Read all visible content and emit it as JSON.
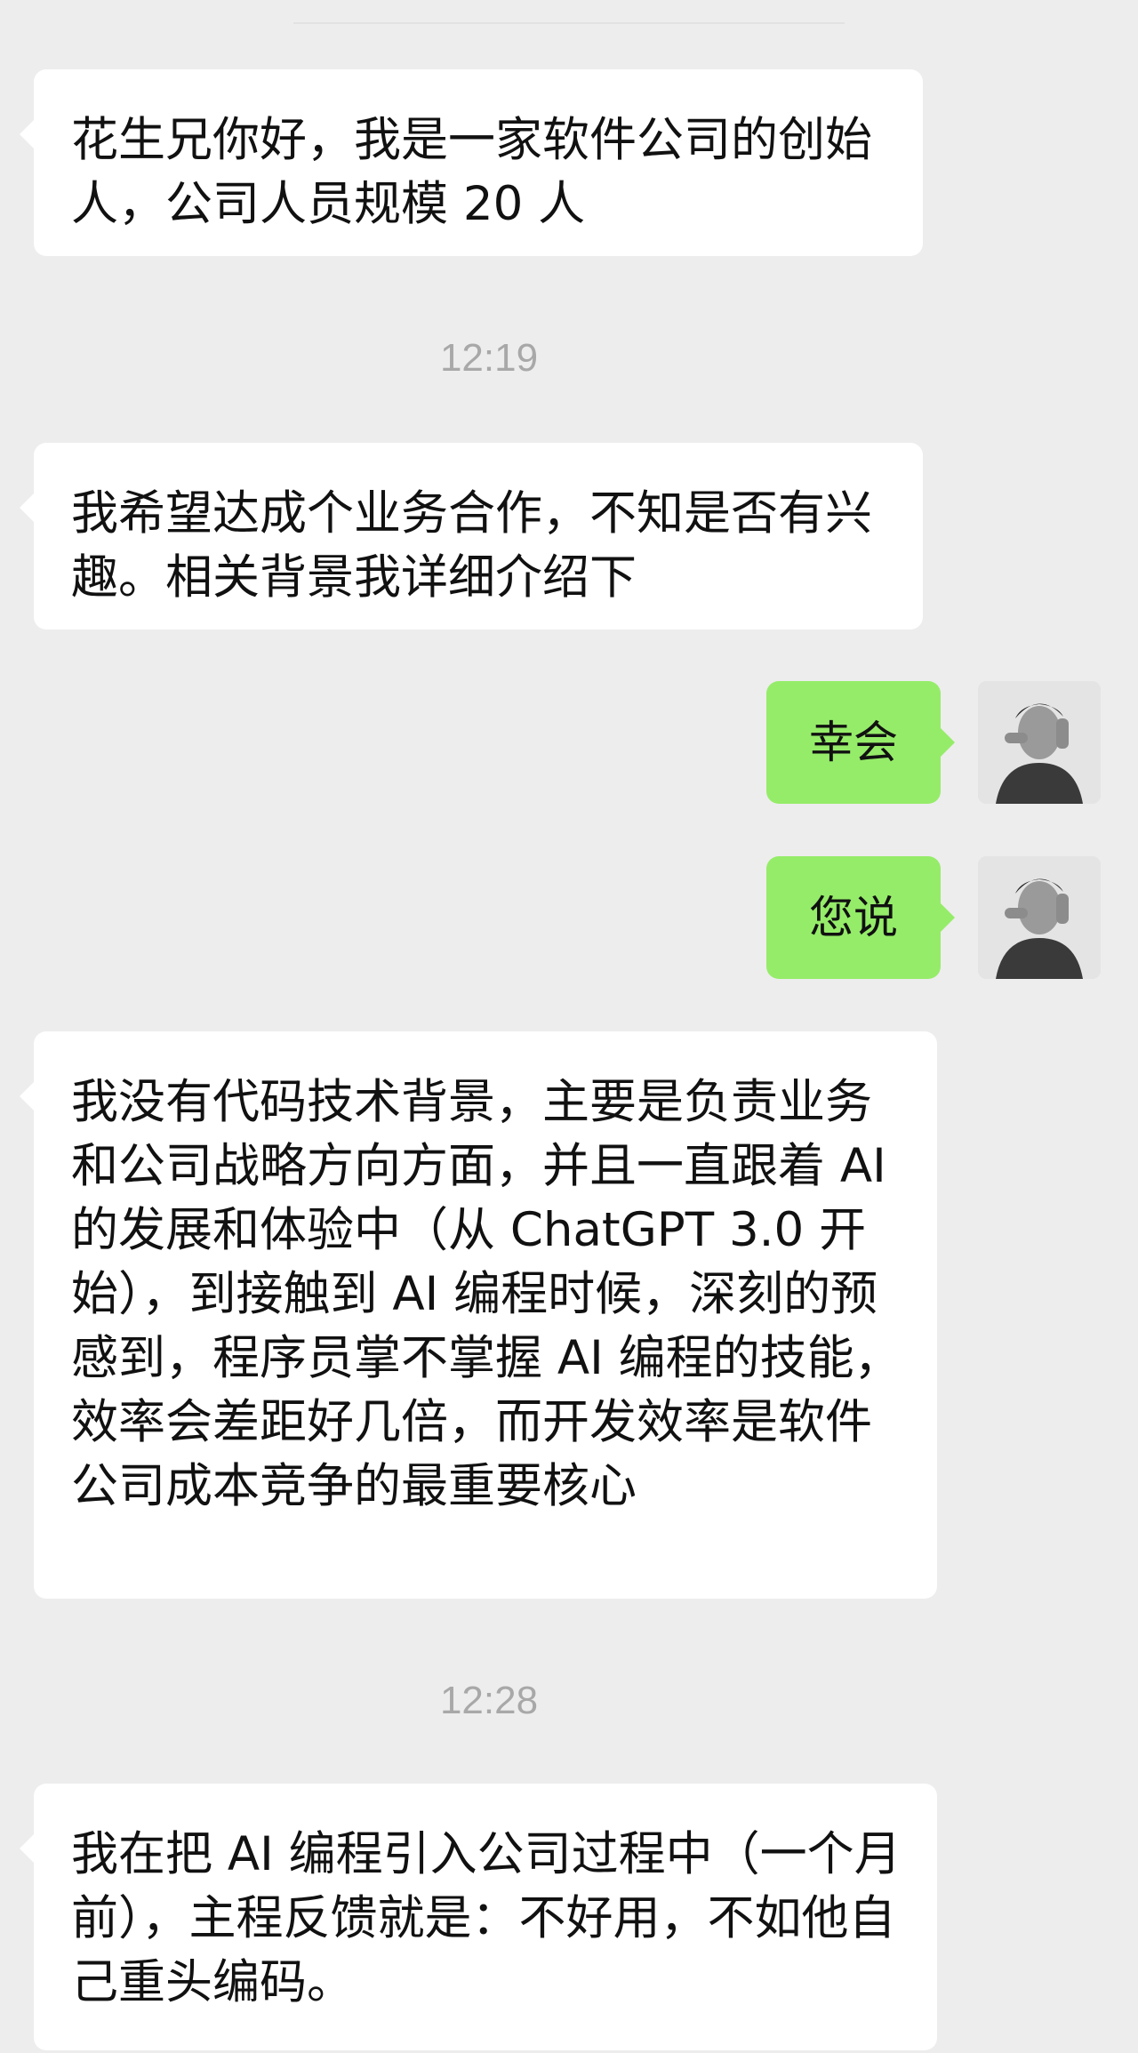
{
  "messages": [
    {
      "side": "in",
      "text": "花生兄你好，我是一家软件公司的创始人，公司人员规模 20 人"
    },
    {
      "type": "time",
      "text": "12:19"
    },
    {
      "side": "in",
      "text": "我希望达成个业务合作，不知是否有兴趣。相关背景我详细介绍下"
    },
    {
      "side": "out",
      "text": "幸会"
    },
    {
      "side": "out",
      "text": "您说"
    },
    {
      "side": "in",
      "text": "我没有代码技术背景，主要是负责业务和公司战略方向方面，并且一直跟着 AI 的发展和体验中（从 ChatGPT 3.0 开始），到接触到 AI 编程时候，深刻的预感到，程序员掌不掌握 AI 编程的技能，效率会差距好几倍，而开发效率是软件公司成本竞争的最重要核心"
    },
    {
      "type": "time",
      "text": "12:28"
    },
    {
      "side": "in",
      "text": "我在把 AI 编程引入公司过程中（一个月前），主程反馈就是：不好用，不如他自己重头编码。"
    }
  ],
  "avatar_icon": "user-avatar-photo",
  "colors": {
    "background": "#ededed",
    "incoming_bubble": "#ffffff",
    "outgoing_bubble": "#95ec69",
    "timestamp": "#a8a8a8"
  }
}
